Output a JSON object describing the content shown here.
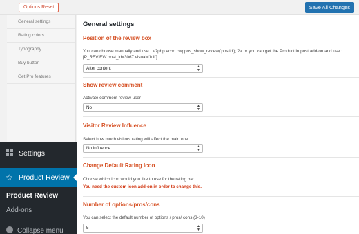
{
  "toolbar": {
    "reset_label": "Options Reset",
    "save_label": "Save All Changes"
  },
  "subnav": {
    "items": [
      "General settings",
      "Rating colors",
      "Typography",
      "Buy button",
      "Get Pro features"
    ]
  },
  "page": {
    "title": "General settings"
  },
  "sections": {
    "position": {
      "title": "Position of the review box",
      "desc_line1": "You can choose manually and use : <?php echo cwppos_show_review('postid'); ?> or you can get the Product in post add-on and use :",
      "desc_line2": "[P_REVIEW post_id=3067 visual='full']",
      "select_value": "After content"
    },
    "comment": {
      "title": "Show review comment",
      "desc": "Activate comment review user",
      "select_value": "No"
    },
    "influence": {
      "title": "Visitor Review Influence",
      "desc": "Select how much visitors rating will affect the main one.",
      "select_value": "No influence"
    },
    "icon": {
      "title": "Change Default Rating Icon",
      "desc": "Choose which icon would you like to use for the rating bar.",
      "warn_pre": "You need the custom icon ",
      "warn_link": "add-on",
      "warn_post": " in order to change this."
    },
    "options": {
      "title": "Number of options/pros/cons",
      "desc": "You can select the default number of options / pros/ cons (3-10)",
      "select_value": "5"
    }
  },
  "admin_menu": {
    "settings_label": "Settings",
    "product_review_label": "Product Review",
    "sub_product_review": "Product Review",
    "sub_addons": "Add-ons",
    "collapse_label": "Collapse menu"
  }
}
